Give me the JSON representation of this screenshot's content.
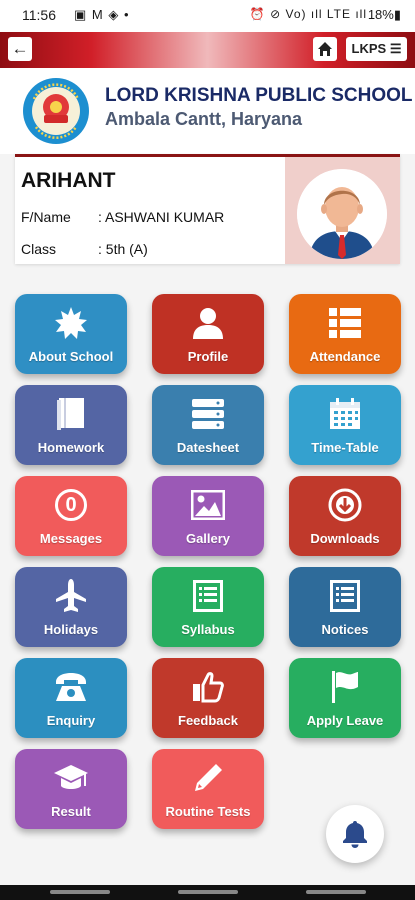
{
  "status_bar": {
    "time": "11:56",
    "left_icons": "▣ M ◈ •",
    "right_icons": "⏰ ⊘ Vo) ıll LTE ıll",
    "battery": "18%▮"
  },
  "app_bar": {
    "back_icon": "←",
    "menu_label": "LKPS ☰"
  },
  "school": {
    "name": "LORD KRISHNA PUBLIC SCHOOL",
    "city": "Ambala Cantt, Haryana"
  },
  "student": {
    "name": "ARIHANT",
    "father_label": "F/Name",
    "father_value": ": ASHWANI KUMAR",
    "class_label": "Class",
    "class_value": ": 5th (A)"
  },
  "tiles": [
    {
      "label": "About School",
      "icon": "burst-icon",
      "color": "#2f8fc4"
    },
    {
      "label": "Profile",
      "icon": "person-icon",
      "color": "#bf3124"
    },
    {
      "label": "Attendance",
      "icon": "list-icon",
      "color": "#e86a12"
    },
    {
      "label": "Homework",
      "icon": "book-icon",
      "color": "#5465a4"
    },
    {
      "label": "Datesheet",
      "icon": "server-icon",
      "color": "#3a7fae"
    },
    {
      "label": "Time-Table",
      "icon": "calendar-icon",
      "color": "#34a1cf"
    },
    {
      "label": "Messages",
      "icon": "counter-icon",
      "counter": "0",
      "color": "#f15b5b"
    },
    {
      "label": "Gallery",
      "icon": "image-icon",
      "color": "#9b59b6"
    },
    {
      "label": "Downloads",
      "icon": "download-icon",
      "color": "#c0392b"
    },
    {
      "label": "Holidays",
      "icon": "plane-icon",
      "color": "#5465a4"
    },
    {
      "label": "Syllabus",
      "icon": "document-icon",
      "color": "#27ae60"
    },
    {
      "label": "Notices",
      "icon": "document-icon",
      "color": "#2e6b9a"
    },
    {
      "label": "Enquiry",
      "icon": "phone-icon",
      "color": "#2c8fc0"
    },
    {
      "label": "Feedback",
      "icon": "thumbs-up-icon",
      "color": "#c0392b"
    },
    {
      "label": "Apply Leave",
      "icon": "flag-icon",
      "color": "#27ae60"
    },
    {
      "label": "Result",
      "icon": "graduation-cap-icon",
      "color": "#9b59b6"
    },
    {
      "label": "Routine Tests",
      "icon": "pencil-icon",
      "color": "#f15b5b"
    }
  ],
  "fab": {
    "icon": "bell-icon"
  }
}
